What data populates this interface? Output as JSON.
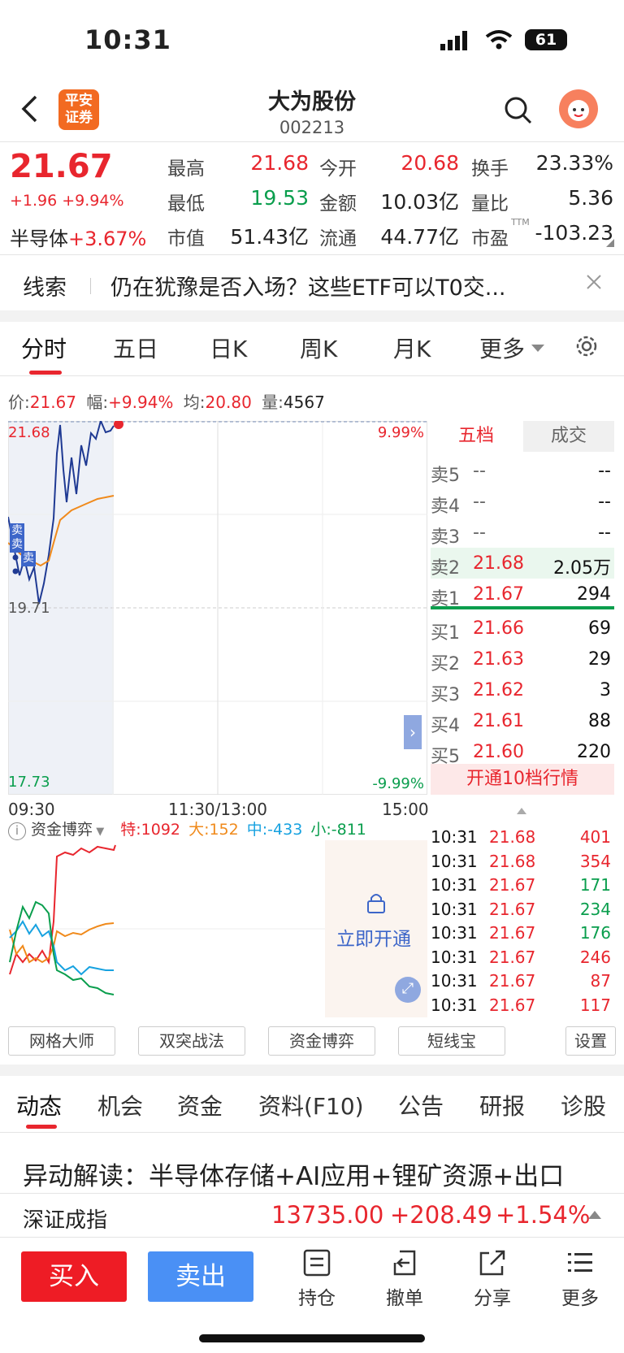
{
  "status": {
    "time": "10:31",
    "battery": "61"
  },
  "header": {
    "logo": "平安\n证券",
    "title": "大为股份",
    "code": "002213"
  },
  "quote": {
    "price": "21.67",
    "change": "+1.96 +9.94%",
    "sector": "半导体",
    "sector_chg": "+3.67%",
    "fields": [
      [
        "最高",
        "21.68",
        "今开",
        "20.68",
        "换手",
        "23.33%"
      ],
      [
        "最低",
        "19.53",
        "金额",
        "10.03亿",
        "量比",
        "5.36"
      ],
      [
        "市值",
        "51.43亿",
        "流通",
        "44.77亿",
        "市盈",
        "-103.23"
      ]
    ],
    "ttm": "TTM"
  },
  "clue": {
    "label": "线索",
    "text": "仍在犹豫是否入场？这些ETF可以T0交..."
  },
  "chart_tabs": [
    "分时",
    "五日",
    "日K",
    "周K",
    "月K",
    "更多"
  ],
  "chart_info": {
    "p_label": "价:",
    "p": "21.67",
    "f_label": "幅:",
    "f": "+9.94%",
    "a_label": "均:",
    "a": "20.80",
    "v_label": "量:",
    "v": "4567"
  },
  "chart": {
    "ymax": "21.68",
    "ymid": "19.71",
    "ymin": "17.73",
    "pmax": "9.99%",
    "pmin": "-9.99%",
    "t0": "09:30",
    "t1": "11:30/13:00",
    "t2": "15:00",
    "sell": "卖"
  },
  "orderbook": {
    "tab1": "五档",
    "tab2": "成交",
    "asks": [
      [
        "卖5",
        "--",
        "--"
      ],
      [
        "卖4",
        "--",
        "--"
      ],
      [
        "卖3",
        "--",
        "--"
      ],
      [
        "卖2",
        "21.68",
        "2.05万"
      ],
      [
        "卖1",
        "21.67",
        "294"
      ]
    ],
    "bids": [
      [
        "买1",
        "21.66",
        "69"
      ],
      [
        "买2",
        "21.63",
        "29"
      ],
      [
        "买3",
        "21.62",
        "3"
      ],
      [
        "买4",
        "21.61",
        "88"
      ],
      [
        "买5",
        "21.60",
        "220"
      ]
    ],
    "open10": "开通10档行情"
  },
  "trades": [
    [
      "10:31",
      "21.68",
      "401",
      "r"
    ],
    [
      "10:31",
      "21.68",
      "354",
      "r"
    ],
    [
      "10:31",
      "21.67",
      "171",
      "g"
    ],
    [
      "10:31",
      "21.67",
      "234",
      "g"
    ],
    [
      "10:31",
      "21.67",
      "176",
      "g"
    ],
    [
      "10:31",
      "21.67",
      "246",
      "r"
    ],
    [
      "10:31",
      "21.67",
      "87",
      "r"
    ],
    [
      "10:31",
      "21.67",
      "117",
      "r"
    ]
  ],
  "flow": {
    "title": "资金博弈",
    "te": "特:1092",
    "da": "大:152",
    "zhong": "中:-433",
    "xiao": "小:-811",
    "unlock": "立即开通"
  },
  "tools": [
    "网格大师",
    "双突战法",
    "资金博弈",
    "短线宝",
    "设置"
  ],
  "bottom_tabs": [
    "动态",
    "机会",
    "资金",
    "资料(F10)",
    "公告",
    "研报",
    "诊股"
  ],
  "news": "异动解读：半导体存储+AI应用+锂矿资源+出口",
  "index": {
    "name": "深证成指",
    "value": "13735.00",
    "chg": "+208.49",
    "pct": "+1.54%"
  },
  "actions": {
    "buy": "买入",
    "sell": "卖出",
    "t1": "持仓",
    "t2": "撤单",
    "t3": "分享",
    "t4": "更多"
  }
}
